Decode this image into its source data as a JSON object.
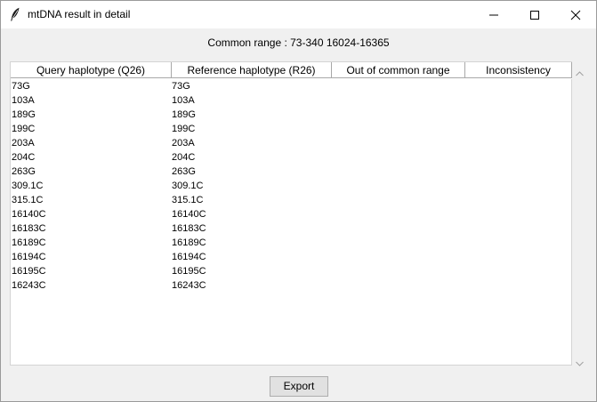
{
  "window": {
    "title": "mtDNA result in detail"
  },
  "icons": {
    "app": "feather-icon",
    "minimize": "minimize-icon",
    "maximize": "maximize-icon",
    "close": "close-icon",
    "scroll_up": "chevron-up-icon",
    "scroll_down": "chevron-down-icon"
  },
  "common_range": "Common range : 73-340 16024-16365",
  "table": {
    "columns": [
      "Query haplotype (Q26)",
      "Reference haplotype (R26)",
      "Out of common range",
      "Inconsistency"
    ],
    "rows": [
      [
        "73G",
        "73G",
        "",
        ""
      ],
      [
        "103A",
        "103A",
        "",
        ""
      ],
      [
        "189G",
        "189G",
        "",
        ""
      ],
      [
        "199C",
        "199C",
        "",
        ""
      ],
      [
        "203A",
        "203A",
        "",
        ""
      ],
      [
        "204C",
        "204C",
        "",
        ""
      ],
      [
        "263G",
        "263G",
        "",
        ""
      ],
      [
        "309.1C",
        "309.1C",
        "",
        ""
      ],
      [
        "315.1C",
        "315.1C",
        "",
        ""
      ],
      [
        "16140C",
        "16140C",
        "",
        ""
      ],
      [
        "16183C",
        "16183C",
        "",
        ""
      ],
      [
        "16189C",
        "16189C",
        "",
        ""
      ],
      [
        "16194C",
        "16194C",
        "",
        ""
      ],
      [
        "16195C",
        "16195C",
        "",
        ""
      ],
      [
        "16243C",
        "16243C",
        "",
        ""
      ]
    ]
  },
  "export_label": "Export"
}
